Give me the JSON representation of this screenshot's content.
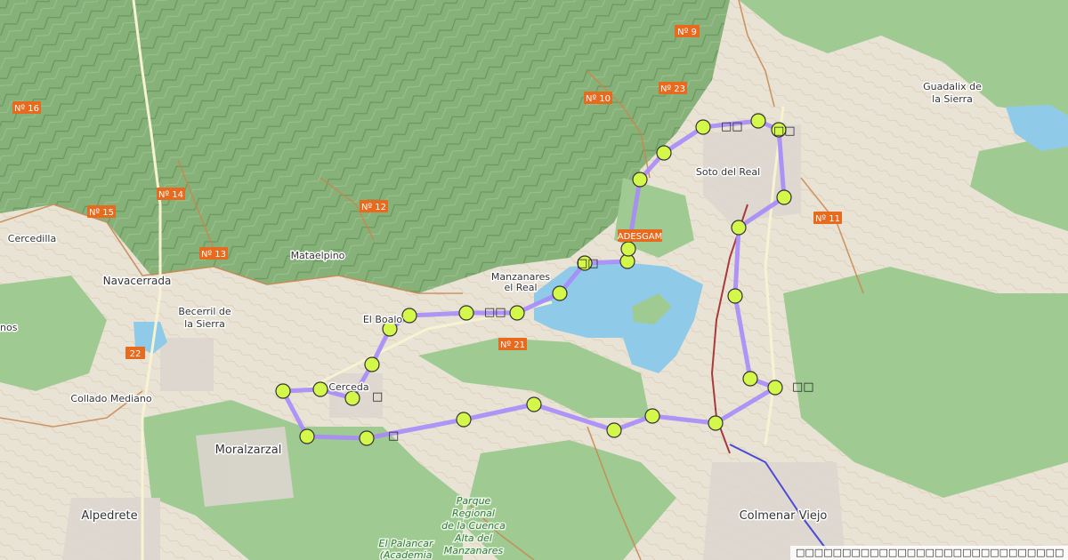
{
  "map": {
    "colors": {
      "terrain": "#e9e3d6",
      "forest": "#9fcb93",
      "forest_dark": "#7fb07a",
      "water": "#8fcbe8",
      "route": "#a78bfa",
      "waypoint": "#d4f84a",
      "road_shield": "#e86a1f",
      "contour": "#c8874f",
      "rail": "#4a4ad6"
    },
    "places": [
      {
        "name": "Guadalix de",
        "name2": "la Sierra"
      },
      {
        "name": "Soto del Real"
      },
      {
        "name": "Cercedilla"
      },
      {
        "name": "Navacerrada"
      },
      {
        "name": "Becerril de",
        "name2": "la Sierra"
      },
      {
        "name": "Mataelpino"
      },
      {
        "name": "Manzanares",
        "name2": "el Real"
      },
      {
        "name": "El Boalo"
      },
      {
        "name": "Cerceda"
      },
      {
        "name": "Collado Mediano"
      },
      {
        "name": "Moralzarzal"
      },
      {
        "name": "Alpedrete"
      },
      {
        "name": "Colmenar Viejo"
      },
      {
        "name": "ADESGAM"
      },
      {
        "name": "nos"
      }
    ],
    "road_shields": [
      "Nº 9",
      "Nº 10",
      "Nº 23",
      "Nº 16",
      "Nº 14",
      "Nº 15",
      "Nº 13",
      "Nº 12",
      "Nº 11",
      "Nº 21",
      "22"
    ],
    "park_label": [
      "Parque",
      "Regional",
      "de la Cuenca",
      "Alta del",
      "Manzanares"
    ],
    "palancar_label": [
      "El Palancar",
      "(Academia"
    ],
    "poi_labels": [
      "□□",
      "□□",
      "□□",
      "□□",
      "□",
      "□",
      "□□"
    ],
    "attribution": "□□□□□□□□□□□□□□□□□□□□□□□□□□□□□"
  }
}
